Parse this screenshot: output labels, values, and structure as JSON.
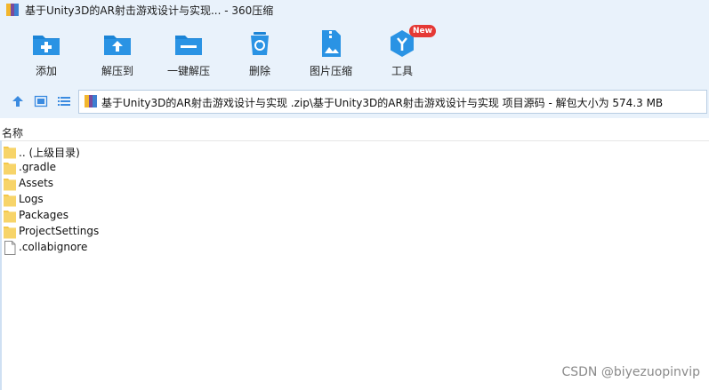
{
  "window": {
    "title": "基于Unity3D的AR射击游戏设计与实现... - 360压缩"
  },
  "toolbar": {
    "items": [
      {
        "label": "添加",
        "icon": "add-icon"
      },
      {
        "label": "解压到",
        "icon": "extract-to-icon"
      },
      {
        "label": "一键解压",
        "icon": "one-click-extract-icon"
      },
      {
        "label": "删除",
        "icon": "delete-icon"
      },
      {
        "label": "图片压缩",
        "icon": "image-compress-icon"
      },
      {
        "label": "工具",
        "icon": "tools-icon",
        "badge": "New"
      }
    ]
  },
  "address": {
    "path": "基于Unity3D的AR射击游戏设计与实现 .zip\\基于Unity3D的AR射击游戏设计与实现 项目源码 - 解包大小为 574.3 MB"
  },
  "list": {
    "column_name": "名称",
    "rows": [
      {
        "name": ".. (上级目录)",
        "type": "folder"
      },
      {
        "name": ".gradle",
        "type": "folder"
      },
      {
        "name": "Assets",
        "type": "folder"
      },
      {
        "name": "Logs",
        "type": "folder"
      },
      {
        "name": "Packages",
        "type": "folder"
      },
      {
        "name": "ProjectSettings",
        "type": "folder"
      },
      {
        "name": ".collabignore",
        "type": "file"
      }
    ]
  },
  "watermark": "CSDN @biyezuopinvip",
  "colors": {
    "accent": "#1b84d6",
    "folder": "#f4c84a",
    "toolbar_bg": "#e9f2fb"
  }
}
